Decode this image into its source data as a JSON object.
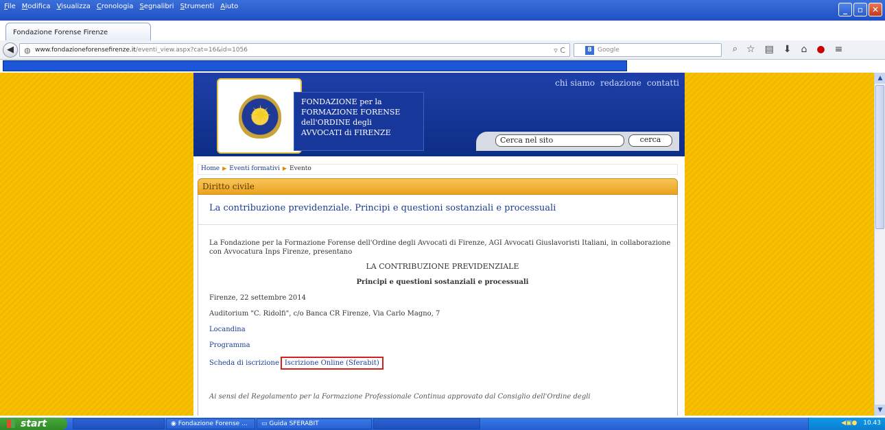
{
  "browser": {
    "menu": [
      "File",
      "Modifica",
      "Visualizza",
      "Cronologia",
      "Segnalibri",
      "Strumenti",
      "Aiuto"
    ],
    "tab_title": "Fondazione Forense Firenze",
    "url_domain": "www.fondazioneforensefirenze.it",
    "url_path": "/eventi_view.aspx?cat=16&id=1056",
    "search_engine": "Google"
  },
  "site": {
    "top_nav": [
      "chi siamo",
      "redazione",
      "contatti"
    ],
    "name_lines": [
      "FONDAZIONE per la",
      "FORMAZIONE FORENSE",
      "dell'ORDINE degli",
      "AVVOCATI di FIRENZE"
    ],
    "search_placeholder": "Cerca nel sito",
    "search_button": "cerca",
    "breadcrumb": [
      "Home",
      "Eventi formativi",
      "Evento"
    ],
    "category": "Diritto civile",
    "event_title": "La contribuzione previdenziale. Principi e questioni sostanziali e processuali",
    "intro": "La Fondazione per la Formazione Forense dell'Ordine degli Avvocati di Firenze, AGI Avvocati Giuslavoristi Italiani, in collaborazione con Avvocatura Inps Firenze, presentano",
    "heading1": "LA CONTRIBUZIONE PREVIDENZIALE",
    "heading2": "Principi e questioni sostanziali e processuali",
    "date": "Firenze, 22 settembre 2014",
    "venue": "Auditorium \"C. Ridolfi\", c/o Banca CR Firenze, Via Carlo Magno, 7",
    "link_locandina": "Locandina",
    "link_programma": "Programma",
    "link_scheda": "Scheda di iscrizione",
    "link_online": "Iscrizione Online (Sferabit)",
    "note": "Ai sensi del Regolamento per la Formazione Professionale Continua approvato dal Consiglio dell'Ordine degli"
  },
  "taskbar": {
    "start": "start",
    "items": [
      "Fondazione Forense ...",
      "Guida SFERABIT"
    ],
    "clock": "10.43"
  },
  "colors": {
    "accent_link": "#1b3c92",
    "highlight_box": "#d41f1f",
    "page_bg": "#f6c200"
  }
}
